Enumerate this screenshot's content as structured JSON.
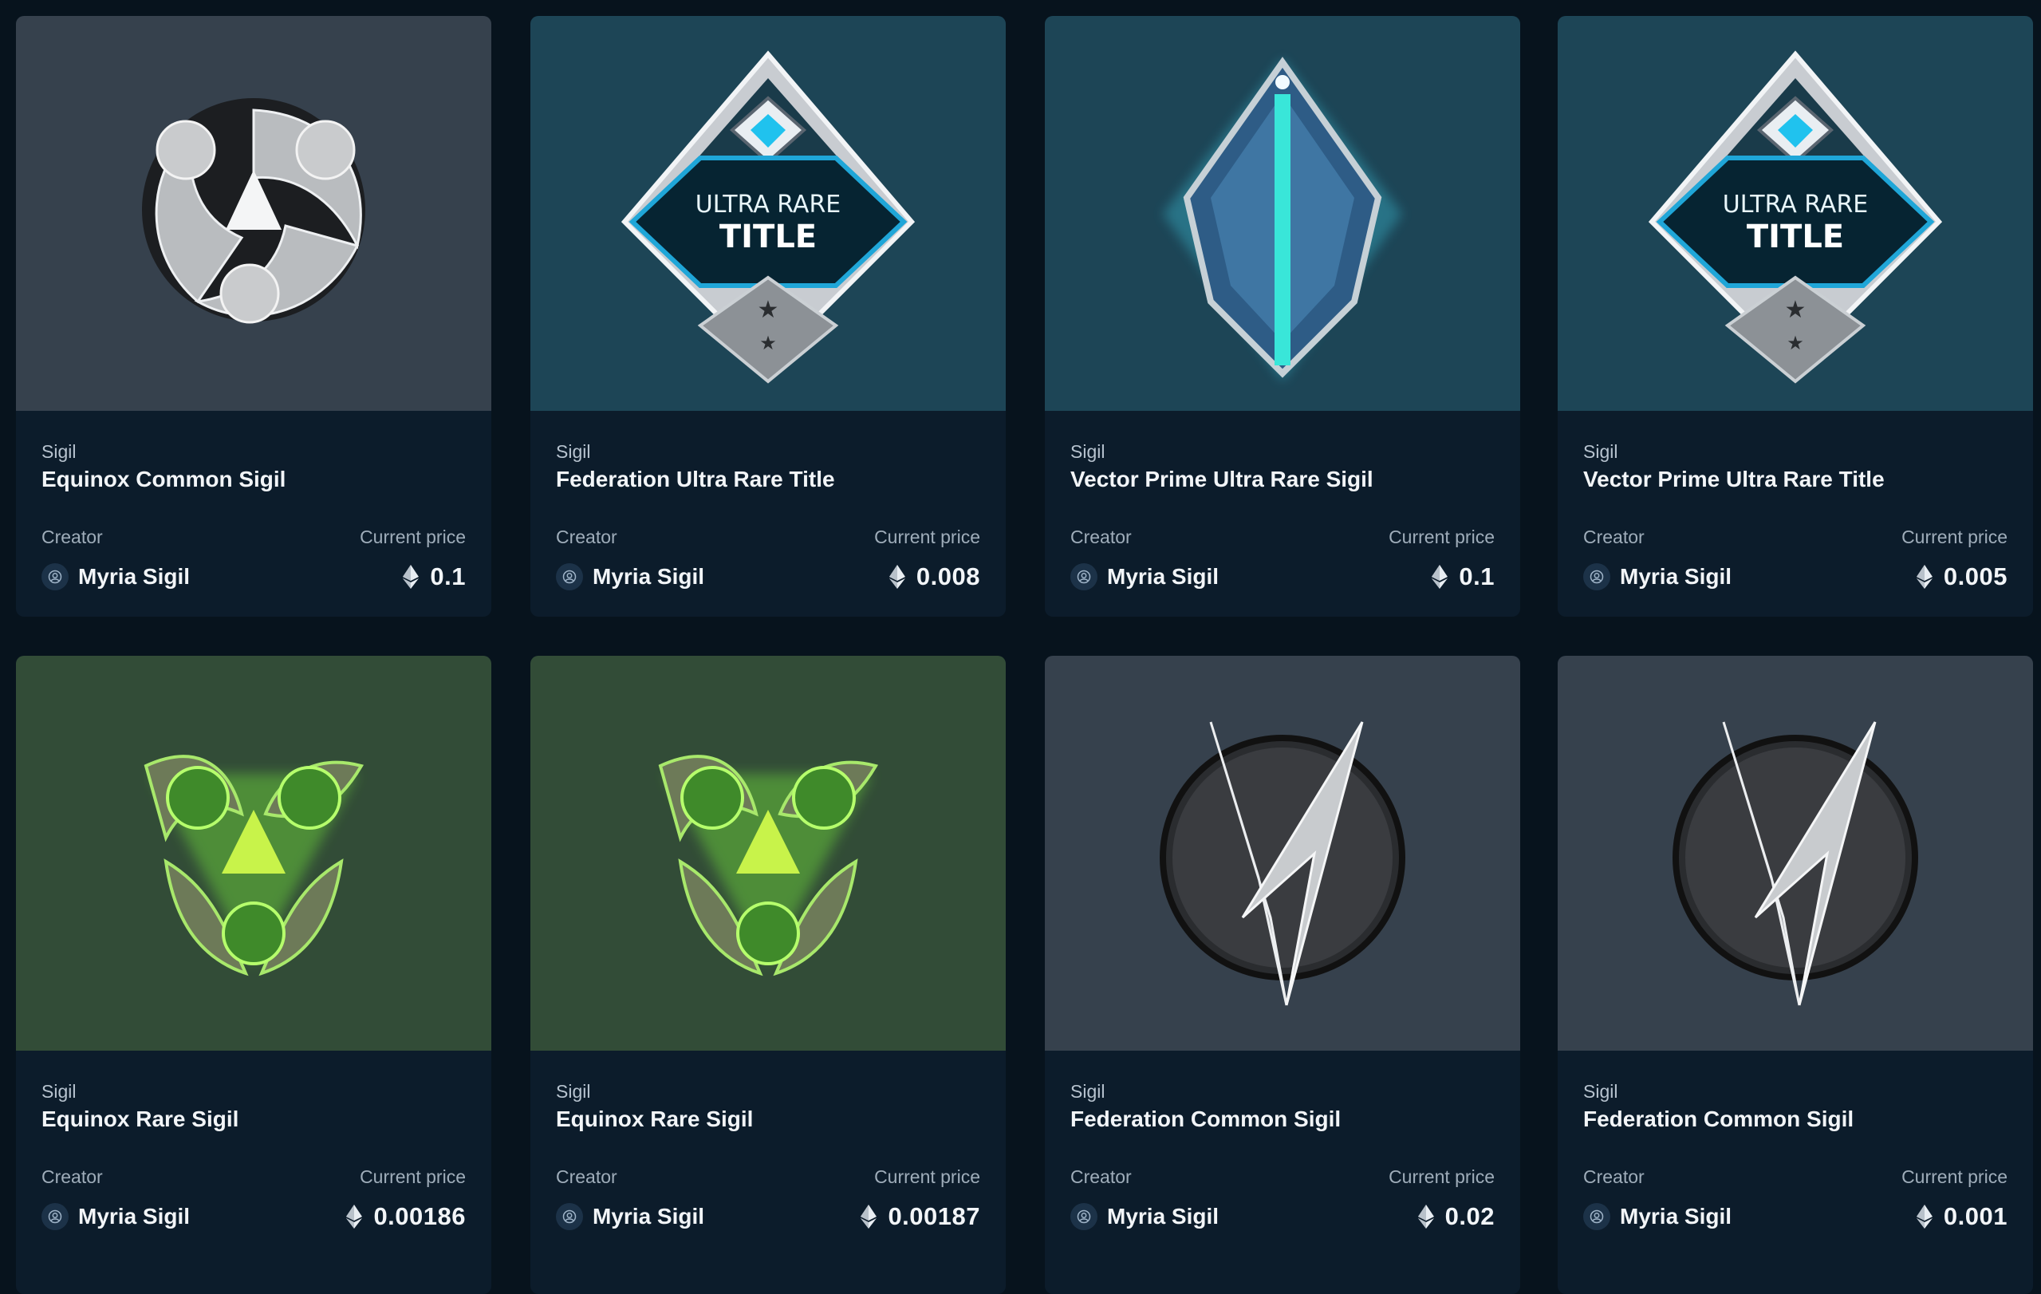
{
  "labels": {
    "creator": "Creator",
    "current_price": "Current price"
  },
  "colors": {
    "page_bg": "#07131d",
    "card_info_bg": "#0c1c2b",
    "thumb_slate": "#36414d",
    "thumb_teal": "#1d4556",
    "thumb_green": "#324c37"
  },
  "items": [
    {
      "type": "Sigil",
      "name": "Equinox Common Sigil",
      "creator": "Myria Sigil",
      "price": "0.1",
      "thumb_bg": "#36414d",
      "art": "equinox-common-sigil-art"
    },
    {
      "type": "Sigil",
      "name": "Federation Ultra Rare Title",
      "creator": "Myria Sigil",
      "price": "0.008",
      "thumb_bg": "#1d4556",
      "art": "ultra-rare-title-badge-art",
      "art_text": [
        "ULTRA RARE",
        "TITLE"
      ]
    },
    {
      "type": "Sigil",
      "name": "Vector Prime Ultra Rare Sigil",
      "creator": "Myria Sigil",
      "price": "0.1",
      "thumb_bg": "#1d4556",
      "art": "vector-prime-sigil-art"
    },
    {
      "type": "Sigil",
      "name": "Vector Prime Ultra Rare Title",
      "creator": "Myria Sigil",
      "price": "0.005",
      "thumb_bg": "#1d4556",
      "art": "ultra-rare-title-badge-art",
      "art_text": [
        "ULTRA RARE",
        "TITLE"
      ]
    },
    {
      "type": "Sigil",
      "name": "Equinox Rare Sigil",
      "creator": "Myria Sigil",
      "price": "0.00186",
      "thumb_bg": "#324c37",
      "art": "equinox-rare-sigil-art"
    },
    {
      "type": "Sigil",
      "name": "Equinox Rare Sigil",
      "creator": "Myria Sigil",
      "price": "0.00187",
      "thumb_bg": "#324c37",
      "art": "equinox-rare-sigil-art"
    },
    {
      "type": "Sigil",
      "name": "Federation Common Sigil",
      "creator": "Myria Sigil",
      "price": "0.02",
      "thumb_bg": "#36414d",
      "art": "federation-common-sigil-art"
    },
    {
      "type": "Sigil",
      "name": "Federation Common Sigil",
      "creator": "Myria Sigil",
      "price": "0.001",
      "thumb_bg": "#36414d",
      "art": "federation-common-sigil-art"
    }
  ]
}
